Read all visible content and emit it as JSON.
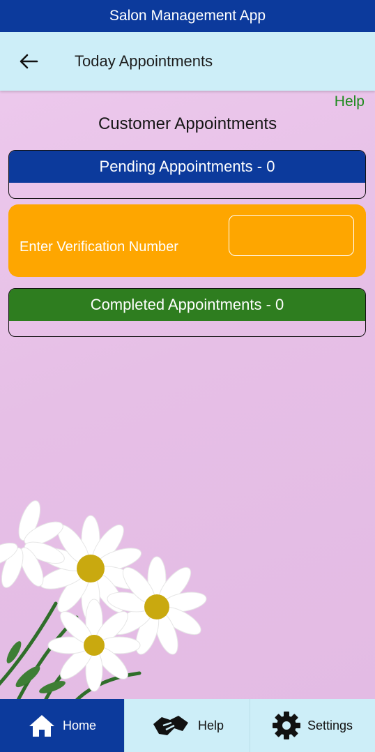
{
  "app_bar": {
    "title": "Salon Management App"
  },
  "toolbar": {
    "back_icon": "arrow-left-icon",
    "title": "Today Appointments"
  },
  "content": {
    "help_link": "Help",
    "section_title": "Customer Appointments",
    "pending": {
      "label": "Pending Appointments - 0",
      "count": 0
    },
    "verification": {
      "label": "Enter Verification Number",
      "value": "",
      "placeholder": ""
    },
    "completed": {
      "label": "Completed Appointments - 0",
      "count": 0
    }
  },
  "bottom_nav": {
    "items": [
      {
        "label": "Home",
        "icon": "home-icon",
        "active": true
      },
      {
        "label": "Help",
        "icon": "handshake-icon",
        "active": false
      },
      {
        "label": "Settings",
        "icon": "gear-icon",
        "active": false
      }
    ]
  },
  "colors": {
    "primary": "#0c3a9c",
    "toolbar": "#cdeef8",
    "background": "#e6c3e6",
    "verify": "#fea600",
    "completed": "#2e7d1f",
    "help_link": "#1d8a1d"
  }
}
